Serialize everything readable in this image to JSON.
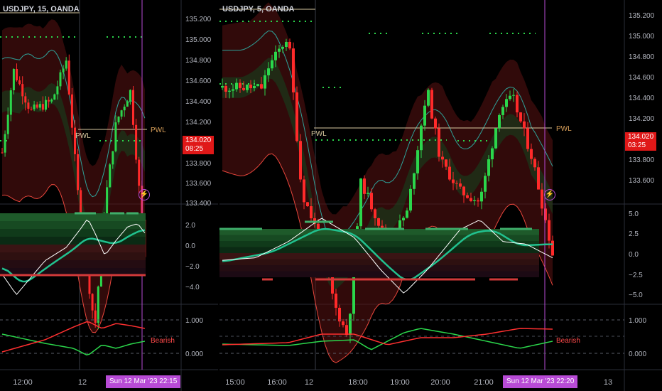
{
  "colors": {
    "bull": "#2bd64b",
    "bear": "#ff2a2a",
    "signal_line": "#21c18f",
    "white_line": "#ffffff",
    "session_line": "#b84bd6",
    "pwl_line": "#d9c9a0",
    "badge_red": "#e01818",
    "time_badge": "#b84bd6"
  },
  "left_chart": {
    "title": "USDJPY, 15, OANDA",
    "price_ticks": [
      "135.200",
      "135.000",
      "134.800",
      "134.600",
      "134.400",
      "134.200",
      "133.800",
      "133.600",
      "133.400"
    ],
    "osc_ticks": [
      "2.0",
      "0.0",
      "−2.0",
      "−4.0"
    ],
    "bot_ticks": [
      "1.000",
      "0.000"
    ],
    "price_badge": {
      "price": "134.020",
      "countdown": "08:25"
    },
    "pwl_label": "PWL",
    "pwl_label_right": "PWL",
    "bearish_label": "Bearish",
    "time_labels": [
      "12:00",
      "12"
    ],
    "time_badge": "Sun 12 Mar '23  22:15",
    "bolt_icon": "⚡"
  },
  "right_chart": {
    "title": "USDJPY, 5, OANDA",
    "price_ticks": [
      "135.200",
      "135.000",
      "134.800",
      "134.600",
      "134.400",
      "134.200",
      "133.800",
      "133.600"
    ],
    "osc_ticks": [
      "5.0",
      "2.5",
      "0.0",
      "−2.5",
      "−5.0"
    ],
    "bot_ticks": [
      "1.000",
      "0.000"
    ],
    "price_badge": {
      "price": "134.020",
      "countdown": "03:25"
    },
    "pwl_label": "PWL",
    "pwl_label_right": "PWL",
    "bearish_label": "Bearish",
    "time_labels": [
      "15:00",
      "16:00",
      "12",
      "18:00",
      "19:00",
      "20:00",
      "21:00",
      "13"
    ],
    "time_badge": "Sun 12 Mar '23  22:20",
    "bolt_icon": "⚡"
  }
}
